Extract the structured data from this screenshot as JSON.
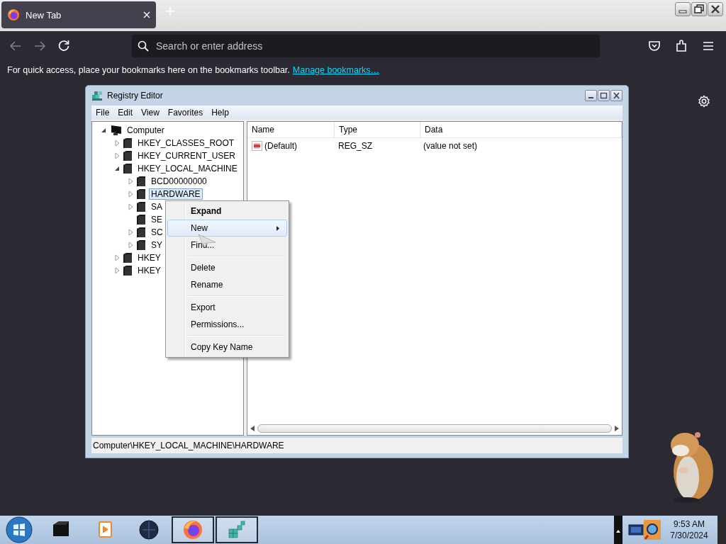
{
  "browser": {
    "tab": {
      "title": "New Tab",
      "selected": true
    },
    "navigation": {
      "back_disabled": true,
      "forward_disabled": true
    },
    "address": {
      "placeholder": "Search or enter address"
    },
    "bookmarks_bar": {
      "message": "For quick access, place your bookmarks here on the bookmarks toolbar.",
      "link": "Manage bookmarks…"
    }
  },
  "registry_editor": {
    "title": "Registry Editor",
    "menu": [
      "File",
      "Edit",
      "View",
      "Favorites",
      "Help"
    ],
    "tree": [
      {
        "label": "Computer",
        "kind": "computer",
        "expanded": true,
        "selected": false,
        "children": [
          {
            "label": "HKEY_CLASSES_ROOT",
            "kind": "key",
            "expanded": false,
            "selected": false
          },
          {
            "label": "HKEY_CURRENT_USER",
            "kind": "key",
            "expanded": false,
            "selected": false
          },
          {
            "label": "HKEY_LOCAL_MACHINE",
            "kind": "key",
            "expanded": true,
            "selected": false,
            "children": [
              {
                "label": "BCD00000000",
                "kind": "key",
                "expanded": false,
                "selected": false
              },
              {
                "label": "HARDWARE",
                "kind": "key",
                "expanded": false,
                "selected": true
              },
              {
                "label": "SA",
                "kind": "key",
                "expanded": false,
                "selected": false
              },
              {
                "label": "SE",
                "kind": "leaf",
                "selected": false
              },
              {
                "label": "SC",
                "kind": "key",
                "expanded": false,
                "selected": false
              },
              {
                "label": "SY",
                "kind": "key",
                "expanded": false,
                "selected": false
              }
            ]
          },
          {
            "label": "HKEY",
            "kind": "key",
            "expanded": false,
            "selected": false
          },
          {
            "label": "HKEY",
            "kind": "key",
            "expanded": false,
            "selected": false
          }
        ]
      }
    ],
    "columns": [
      "Name",
      "Type",
      "Data"
    ],
    "values": [
      {
        "name": "(Default)",
        "type": "REG_SZ",
        "data": "(value not set)"
      }
    ],
    "status_bar": "Computer\\HKEY_LOCAL_MACHINE\\HARDWARE",
    "context_menu": [
      [
        {
          "label": "Expand",
          "default": true,
          "submenu": false,
          "selected": false
        },
        {
          "label": "New",
          "default": false,
          "submenu": true,
          "selected": true
        },
        {
          "label": "Find...",
          "default": false,
          "submenu": false,
          "selected": false
        }
      ],
      [
        {
          "label": "Delete",
          "default": false,
          "submenu": false,
          "selected": false
        },
        {
          "label": "Rename",
          "default": false,
          "submenu": false,
          "selected": false
        }
      ],
      [
        {
          "label": "Export",
          "default": false,
          "submenu": false,
          "selected": false
        },
        {
          "label": "Permissions...",
          "default": false,
          "submenu": false,
          "selected": false
        }
      ],
      [
        {
          "label": "Copy Key Name",
          "default": false,
          "submenu": false,
          "selected": false
        }
      ]
    ]
  },
  "taskbar": {
    "items": [
      {
        "kind": "box",
        "active": false
      },
      {
        "kind": "media",
        "active": false
      },
      {
        "kind": "globe",
        "active": false
      },
      {
        "kind": "firefox",
        "active": true
      },
      {
        "kind": "registry",
        "active": true
      }
    ],
    "clock": {
      "time": "9:53 AM",
      "date": "7/30/2024"
    }
  }
}
